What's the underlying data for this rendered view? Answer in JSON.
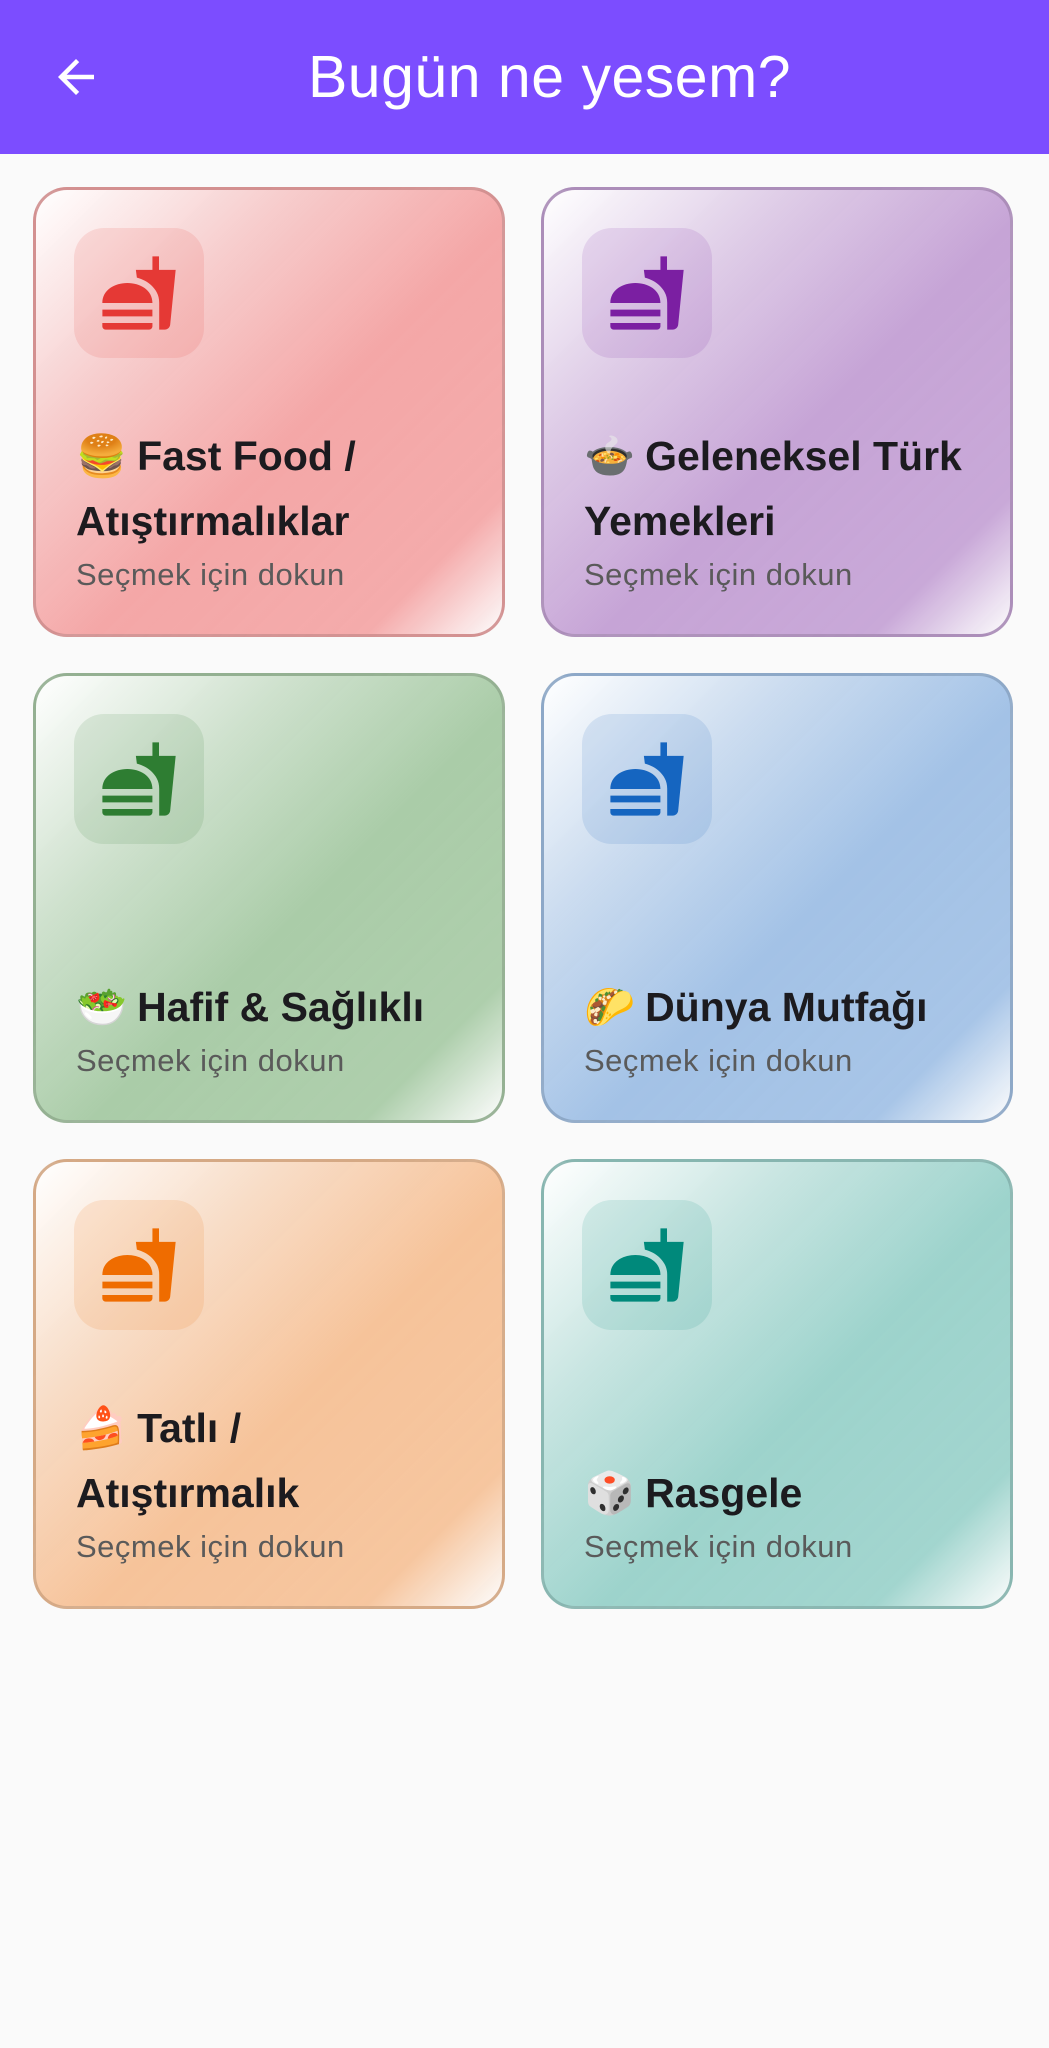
{
  "appbar": {
    "title": "Bugün ne yesem?",
    "back_icon": "arrow-back-icon",
    "background": "#7c4dff"
  },
  "cards": [
    {
      "emoji": "🍔",
      "title": "Fast Food / Atıştırmalıklar",
      "subtitle": "Seçmek için dokun",
      "icon": "fastfood-icon",
      "icon_color": "#e53935",
      "tint": "#f4a7a7"
    },
    {
      "emoji": "🍲",
      "title": "Geleneksel Türk Yemekleri",
      "subtitle": "Seçmek için dokun",
      "icon": "fastfood-icon",
      "icon_color": "#7b1fa2",
      "tint": "#c6a4d6"
    },
    {
      "emoji": "🥗",
      "title": "Hafif & Sağlıklı",
      "subtitle": "Seçmek için dokun",
      "icon": "fastfood-icon",
      "icon_color": "#2e7d32",
      "tint": "#aacca8"
    },
    {
      "emoji": "🌮",
      "title": "Dünya Mutfağı",
      "subtitle": "Seçmek için dokun",
      "icon": "fastfood-icon",
      "icon_color": "#1565c0",
      "tint": "#a3c2e6"
    },
    {
      "emoji": "🍰",
      "title": "Tatlı / Atıştırmalık",
      "subtitle": "Seçmek için dokun",
      "icon": "fastfood-icon",
      "icon_color": "#ef6c00",
      "tint": "#f6c39a"
    },
    {
      "emoji": "🎲",
      "title": "Rasgele",
      "subtitle": "Seçmek için dokun",
      "icon": "fastfood-icon",
      "icon_color": "#00897b",
      "tint": "#9dd3cc"
    }
  ]
}
